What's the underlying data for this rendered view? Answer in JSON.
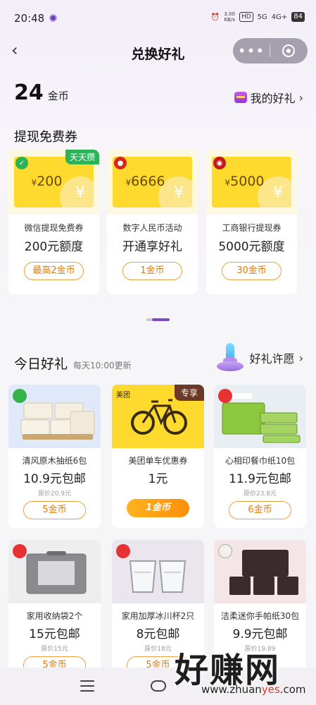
{
  "status_bar": {
    "time": "20:48",
    "speed_top": "3.00",
    "speed_bottom": "KB/s",
    "hd": "HD",
    "net1": "5G",
    "net2": "4G+",
    "battery": "84"
  },
  "header": {
    "title": "兑换好礼"
  },
  "wallet": {
    "coins": "24",
    "coins_unit": "金币",
    "my_gifts_label": "我的好礼",
    "chevron": "›"
  },
  "withdraw": {
    "title": "提现免费券",
    "coupons": [
      {
        "amount": "200",
        "currency": "¥",
        "brand_icon": "wechat-check-icon",
        "brand_color": "#2db357",
        "tag": "天天攒",
        "line1": "微信提现免费券",
        "line2": "200元额度",
        "button": "最高2金币"
      },
      {
        "amount": "6666",
        "currency": "¥",
        "brand_icon": "digital-rmb-icon",
        "brand_color": "#d9261c",
        "tag": "",
        "line1": "数字人民币活动",
        "line2": "开通享好礼",
        "button": "1金币"
      },
      {
        "amount": "5000",
        "currency": "¥",
        "brand_icon": "icbc-icon",
        "brand_color": "#c8161d",
        "tag": "",
        "line1": "工商银行提现券",
        "line2": "5000元额度",
        "button": "30金币"
      }
    ]
  },
  "today": {
    "title": "今日好礼",
    "subtitle": "每天10:00更新",
    "wish_label": "好礼许愿",
    "products": [
      {
        "name": "清风原木抽纸6包",
        "price": "10.9元包邮",
        "original": "原价20.9元",
        "button": "5金币",
        "image": "tissue-packs",
        "bg": "#dfe9fa"
      },
      {
        "name": "美团单车优惠券",
        "price": "1元",
        "original": "",
        "button": "1金币",
        "image": "bicycle",
        "bg": "#fed92e",
        "brand": "美团",
        "badge": "专享"
      },
      {
        "name": "心相印餐巾纸10包",
        "price": "11.9元包邮",
        "original": "原价23.8元",
        "button": "6金币",
        "image": "napkin-packs",
        "bg": "#e8eef2"
      },
      {
        "name": "家用收纳袋2个",
        "price": "15元包邮",
        "original": "原价15元",
        "button": "5金币",
        "image": "storage-bag",
        "bg": "#eeeeef"
      },
      {
        "name": "家用加厚冰川杯2只",
        "price": "8元包邮",
        "original": "原价18元",
        "button": "5金币",
        "image": "glass-cups",
        "bg": "#ebe6ee"
      },
      {
        "name": "洁柔迷你手帕纸30包",
        "price": "9.9元包邮",
        "original": "原价19.89",
        "button": "",
        "image": "pocket-tissue",
        "bg": "#f4e5e6"
      }
    ]
  },
  "watermark": {
    "text": "好赚网",
    "url_a": "www.zhuan",
    "url_b": "yes",
    "url_c": ".com"
  },
  "colors": {
    "accent_orange": "#f0a040",
    "coupon_yellow": "#fed92e",
    "pager_active": "#7b4bc4"
  }
}
